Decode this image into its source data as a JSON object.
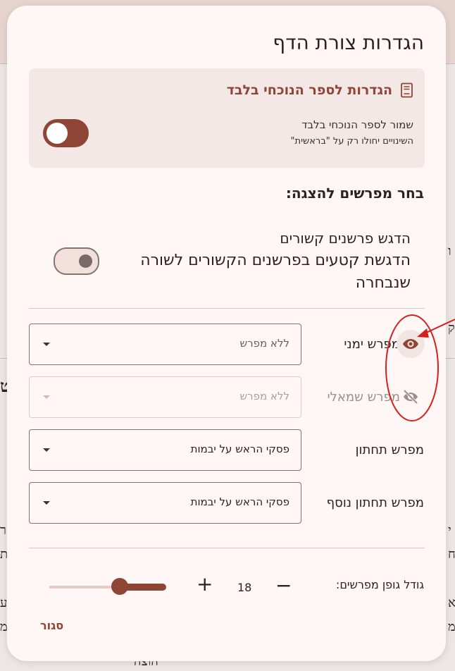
{
  "dialog": {
    "title": "הגדרות צורת הדף",
    "close_label": "סגור"
  },
  "book_settings": {
    "title": "הגדרות לספר הנוכחי בלבד",
    "icon": "book-icon",
    "save_label": "שמור לספר הנוכחי בלבד",
    "save_sublabel": "השינויים יחולו רק על \"בראשית\"",
    "save_enabled": true
  },
  "commentators": {
    "heading": "בחר מפרשים להצגה:",
    "highlight_title": "הדגש פרשנים קשורים",
    "highlight_desc": "הדגשת קטעים בפרשנים הקשורים לשורה שנבחרה",
    "highlight_enabled": false,
    "rows": [
      {
        "label": "מפרש ימני",
        "value": "ללא מפרש",
        "icon": "eye-icon",
        "visible": true
      },
      {
        "label": "מפרש שמאלי",
        "value": "ללא מפרש",
        "icon": "eye-off-icon",
        "visible": false
      },
      {
        "label": "מפרש תחתון",
        "value": "פסקי הראש על יבמות"
      },
      {
        "label": "מפרש תחתון נוסף",
        "value": "פסקי הראש על יבמות"
      }
    ]
  },
  "font_size": {
    "label": "גודל גופן מפרשים:",
    "value": "18",
    "minus": "−",
    "plus": "+",
    "slider_fraction": 0.6
  },
  "colors": {
    "accent": "#8f4536",
    "annotation": "#d42020"
  }
}
